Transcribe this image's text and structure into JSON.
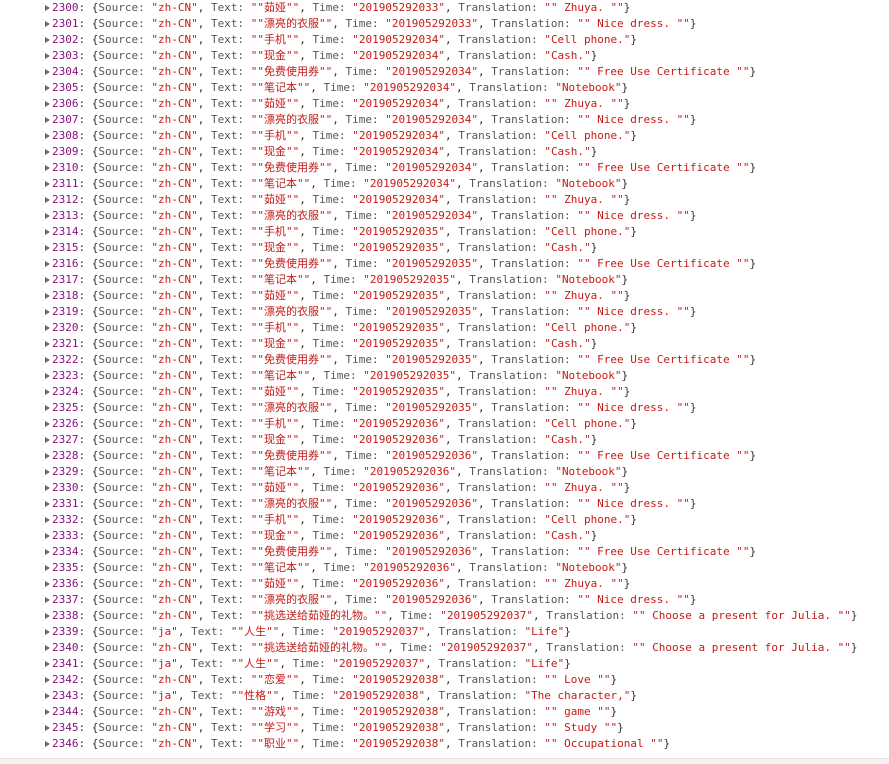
{
  "app": "devtools-console",
  "rows": [
    {
      "i": "2300",
      "src": "zh-CN",
      "text": "\"茹娅\"",
      "time": "201905292033",
      "tr": "\" Zhuya. \""
    },
    {
      "i": "2301",
      "src": "zh-CN",
      "text": "\"漂亮的衣服\"",
      "time": "201905292033",
      "tr": "\" Nice dress. \""
    },
    {
      "i": "2302",
      "src": "zh-CN",
      "text": "\"手机\"",
      "time": "201905292034",
      "tr": "Cell phone."
    },
    {
      "i": "2303",
      "src": "zh-CN",
      "text": "\"现金\"",
      "time": "201905292034",
      "tr": "Cash."
    },
    {
      "i": "2304",
      "src": "zh-CN",
      "text": "\"免费使用券\"",
      "time": "201905292034",
      "tr": "\" Free Use Certificate \""
    },
    {
      "i": "2305",
      "src": "zh-CN",
      "text": "\"笔记本\"",
      "time": "201905292034",
      "tr": "Notebook"
    },
    {
      "i": "2306",
      "src": "zh-CN",
      "text": "\"茹娅\"",
      "time": "201905292034",
      "tr": "\" Zhuya. \""
    },
    {
      "i": "2307",
      "src": "zh-CN",
      "text": "\"漂亮的衣服\"",
      "time": "201905292034",
      "tr": "\" Nice dress. \""
    },
    {
      "i": "2308",
      "src": "zh-CN",
      "text": "\"手机\"",
      "time": "201905292034",
      "tr": "Cell phone."
    },
    {
      "i": "2309",
      "src": "zh-CN",
      "text": "\"现金\"",
      "time": "201905292034",
      "tr": "Cash."
    },
    {
      "i": "2310",
      "src": "zh-CN",
      "text": "\"免费使用券\"",
      "time": "201905292034",
      "tr": "\" Free Use Certificate \""
    },
    {
      "i": "2311",
      "src": "zh-CN",
      "text": "\"笔记本\"",
      "time": "201905292034",
      "tr": "Notebook"
    },
    {
      "i": "2312",
      "src": "zh-CN",
      "text": "\"茹娅\"",
      "time": "201905292034",
      "tr": "\" Zhuya. \""
    },
    {
      "i": "2313",
      "src": "zh-CN",
      "text": "\"漂亮的衣服\"",
      "time": "201905292034",
      "tr": "\" Nice dress. \""
    },
    {
      "i": "2314",
      "src": "zh-CN",
      "text": "\"手机\"",
      "time": "201905292035",
      "tr": "Cell phone."
    },
    {
      "i": "2315",
      "src": "zh-CN",
      "text": "\"现金\"",
      "time": "201905292035",
      "tr": "Cash."
    },
    {
      "i": "2316",
      "src": "zh-CN",
      "text": "\"免费使用券\"",
      "time": "201905292035",
      "tr": "\" Free Use Certificate \""
    },
    {
      "i": "2317",
      "src": "zh-CN",
      "text": "\"笔记本\"",
      "time": "201905292035",
      "tr": "Notebook"
    },
    {
      "i": "2318",
      "src": "zh-CN",
      "text": "\"茹娅\"",
      "time": "201905292035",
      "tr": "\" Zhuya. \""
    },
    {
      "i": "2319",
      "src": "zh-CN",
      "text": "\"漂亮的衣服\"",
      "time": "201905292035",
      "tr": "\" Nice dress. \""
    },
    {
      "i": "2320",
      "src": "zh-CN",
      "text": "\"手机\"",
      "time": "201905292035",
      "tr": "Cell phone."
    },
    {
      "i": "2321",
      "src": "zh-CN",
      "text": "\"现金\"",
      "time": "201905292035",
      "tr": "Cash."
    },
    {
      "i": "2322",
      "src": "zh-CN",
      "text": "\"免费使用券\"",
      "time": "201905292035",
      "tr": "\" Free Use Certificate \""
    },
    {
      "i": "2323",
      "src": "zh-CN",
      "text": "\"笔记本\"",
      "time": "201905292035",
      "tr": "Notebook"
    },
    {
      "i": "2324",
      "src": "zh-CN",
      "text": "\"茹娅\"",
      "time": "201905292035",
      "tr": "\" Zhuya. \""
    },
    {
      "i": "2325",
      "src": "zh-CN",
      "text": "\"漂亮的衣服\"",
      "time": "201905292035",
      "tr": "\" Nice dress. \""
    },
    {
      "i": "2326",
      "src": "zh-CN",
      "text": "\"手机\"",
      "time": "201905292036",
      "tr": "Cell phone."
    },
    {
      "i": "2327",
      "src": "zh-CN",
      "text": "\"现金\"",
      "time": "201905292036",
      "tr": "Cash."
    },
    {
      "i": "2328",
      "src": "zh-CN",
      "text": "\"免费使用券\"",
      "time": "201905292036",
      "tr": "\" Free Use Certificate \""
    },
    {
      "i": "2329",
      "src": "zh-CN",
      "text": "\"笔记本\"",
      "time": "201905292036",
      "tr": "Notebook"
    },
    {
      "i": "2330",
      "src": "zh-CN",
      "text": "\"茹娅\"",
      "time": "201905292036",
      "tr": "\" Zhuya. \""
    },
    {
      "i": "2331",
      "src": "zh-CN",
      "text": "\"漂亮的衣服\"",
      "time": "201905292036",
      "tr": "\" Nice dress. \""
    },
    {
      "i": "2332",
      "src": "zh-CN",
      "text": "\"手机\"",
      "time": "201905292036",
      "tr": "Cell phone."
    },
    {
      "i": "2333",
      "src": "zh-CN",
      "text": "\"现金\"",
      "time": "201905292036",
      "tr": "Cash."
    },
    {
      "i": "2334",
      "src": "zh-CN",
      "text": "\"免费使用券\"",
      "time": "201905292036",
      "tr": "\" Free Use Certificate \""
    },
    {
      "i": "2335",
      "src": "zh-CN",
      "text": "\"笔记本\"",
      "time": "201905292036",
      "tr": "Notebook"
    },
    {
      "i": "2336",
      "src": "zh-CN",
      "text": "\"茹娅\"",
      "time": "201905292036",
      "tr": "\" Zhuya. \""
    },
    {
      "i": "2337",
      "src": "zh-CN",
      "text": "\"漂亮的衣服\"",
      "time": "201905292036",
      "tr": "\" Nice dress. \""
    },
    {
      "i": "2338",
      "src": "zh-CN",
      "text": "\"挑选送给茹娅的礼物。\"",
      "time": "201905292037",
      "tr": "\" Choose a present for Julia. \""
    },
    {
      "i": "2339",
      "src": "ja",
      "text": "\"人生\"",
      "time": "201905292037",
      "tr": "Life"
    },
    {
      "i": "2340",
      "src": "zh-CN",
      "text": "\"挑选送给茹娅的礼物。\"",
      "time": "201905292037",
      "tr": "\" Choose a present for Julia. \""
    },
    {
      "i": "2341",
      "src": "ja",
      "text": "\"人生\"",
      "time": "201905292037",
      "tr": "Life"
    },
    {
      "i": "2342",
      "src": "zh-CN",
      "text": "\"恋爱\"",
      "time": "201905292038",
      "tr": "\" Love \""
    },
    {
      "i": "2343",
      "src": "ja",
      "text": "\"性格\"",
      "time": "201905292038",
      "tr": "The character,"
    },
    {
      "i": "2344",
      "src": "zh-CN",
      "text": "\"游戏\"",
      "time": "201905292038",
      "tr": "\" game \""
    },
    {
      "i": "2345",
      "src": "zh-CN",
      "text": "\"学习\"",
      "time": "201905292038",
      "tr": "\" Study \""
    },
    {
      "i": "2346",
      "src": "zh-CN",
      "text": "\"职业\"",
      "time": "201905292038",
      "tr": "\" Occupational \""
    }
  ]
}
